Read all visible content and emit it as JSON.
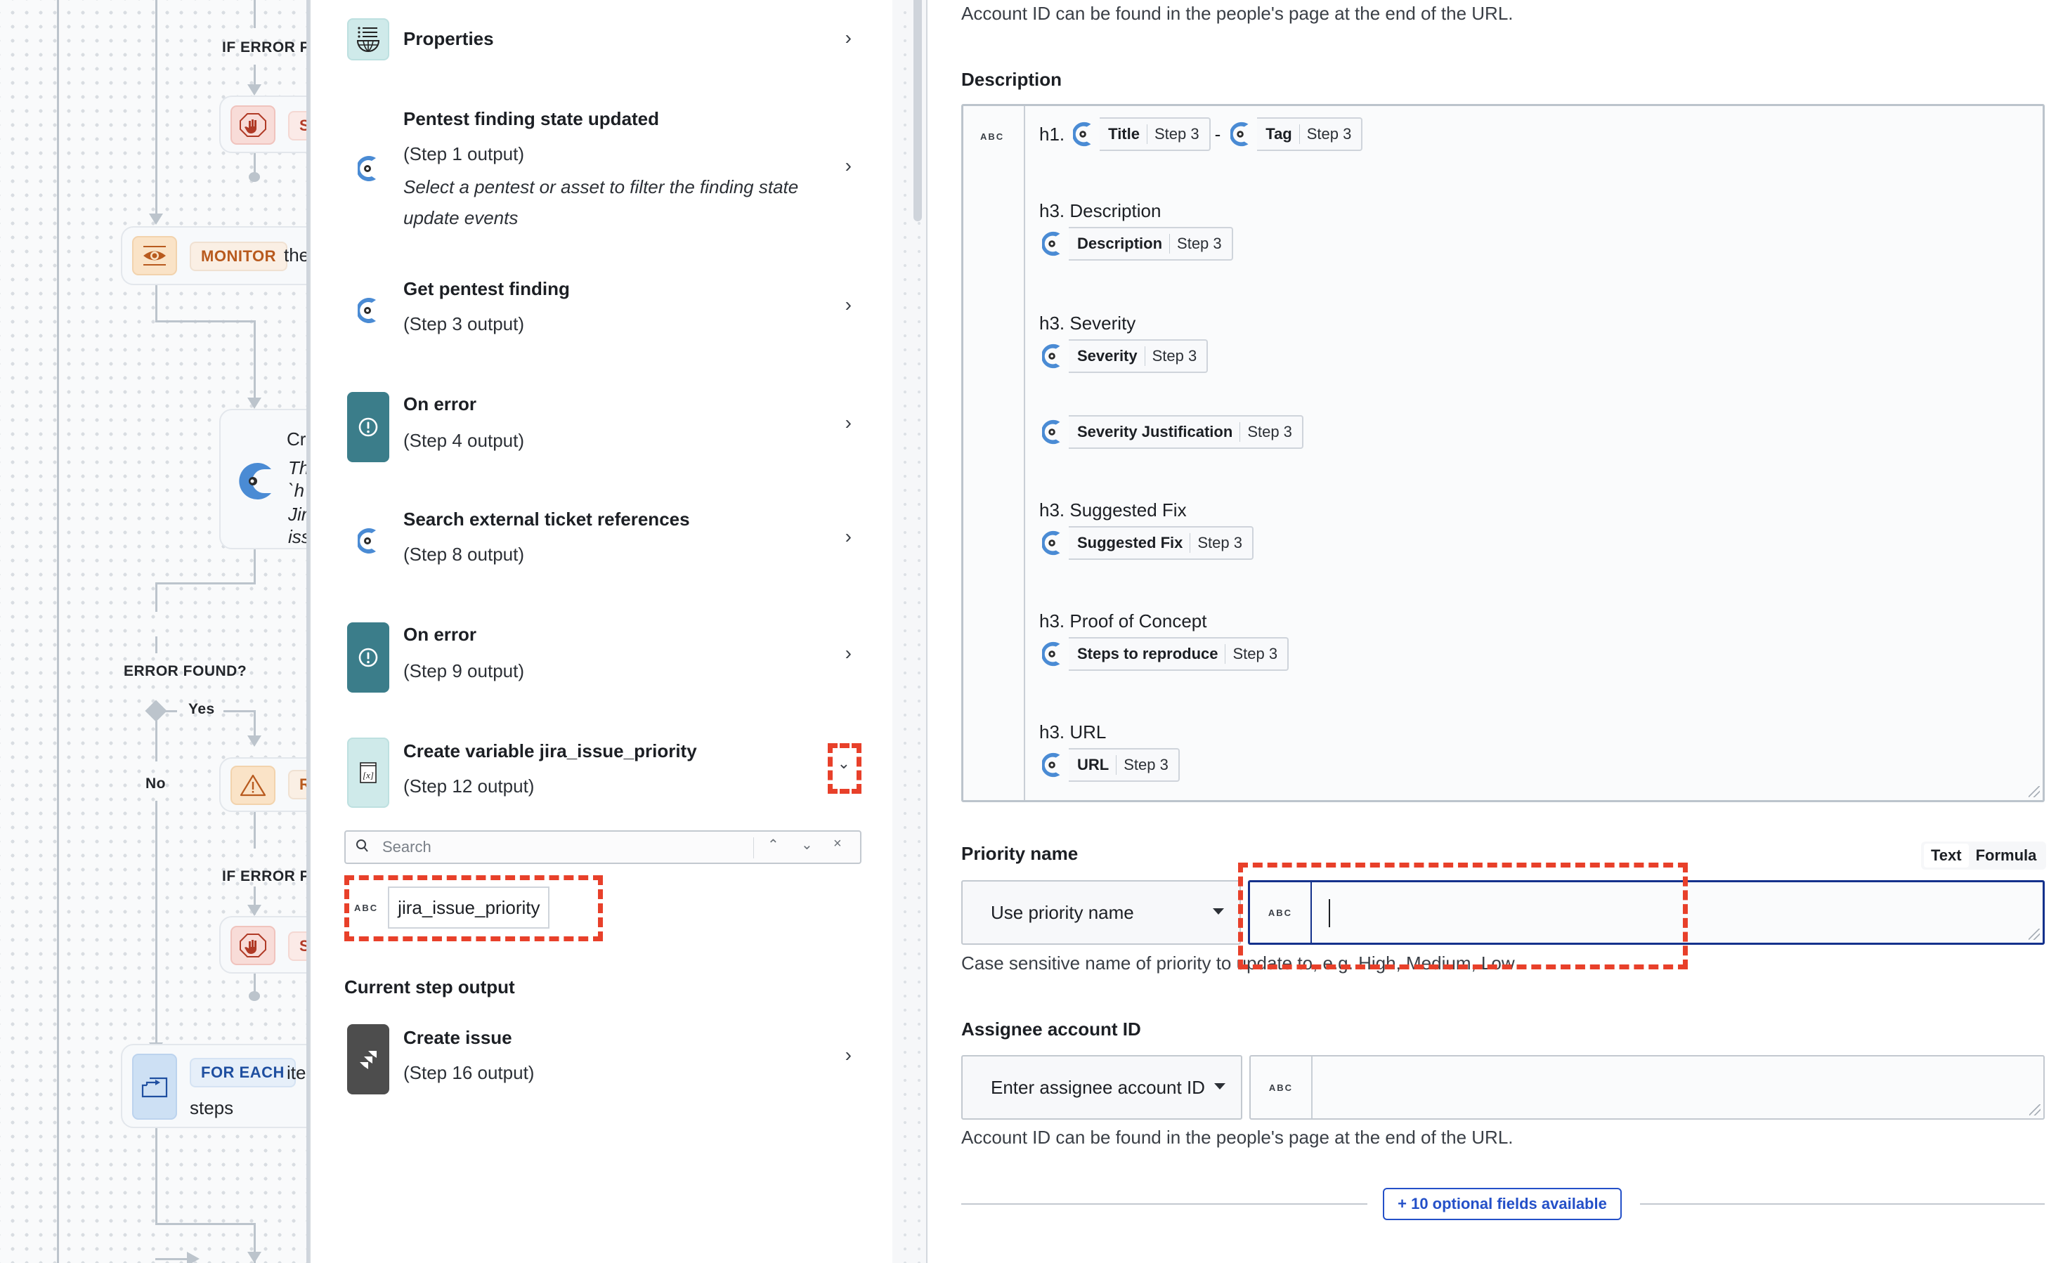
{
  "canvas": {
    "labels": {
      "if_error_top": "IF ERROR PE",
      "if_error_bottom": "IF ERROR PE",
      "error_found": "ERROR FOUND?",
      "yes": "Yes",
      "no": "No"
    },
    "nodes": {
      "stop_top_badge": "ST",
      "monitor_badge": "MONITOR",
      "monitor_text": "the",
      "create_title": "Cre",
      "create_lines": [
        "Th",
        "`h",
        "Jir",
        "iss"
      ],
      "retry_badge": "RI",
      "stop_bottom_badge": "ST",
      "foreach_badge": "FOR EACH",
      "foreach_text": "ite",
      "foreach_sub": "steps"
    }
  },
  "middle": {
    "items": [
      {
        "title": "Properties",
        "icon": "properties-globe-icon"
      },
      {
        "title": "Pentest finding state updated",
        "sub": "(Step 1 output)",
        "desc": "Select a pentest or asset to filter the finding state update events",
        "icon": "cobalt-logo-icon"
      },
      {
        "title": "Get pentest finding",
        "sub": "(Step 3 output)",
        "icon": "cobalt-logo-icon"
      },
      {
        "title": "On error",
        "sub": "(Step 4 output)",
        "icon": "error-exclamation-icon"
      },
      {
        "title": "Search external ticket references",
        "sub": "(Step 8 output)",
        "icon": "cobalt-logo-icon"
      },
      {
        "title": "On error",
        "sub": "(Step 9 output)",
        "icon": "error-exclamation-icon"
      },
      {
        "title": "Create variable jira_issue_priority",
        "sub": "(Step 12 output)",
        "icon": "variable-x-icon"
      }
    ],
    "search": {
      "placeholder": "Search"
    },
    "variable": {
      "type": "ABC",
      "name": "jira_issue_priority"
    },
    "current_step_title": "Current step output",
    "current_step": {
      "title": "Create issue",
      "sub": "(Step 16 output)",
      "icon": "jira-logo-icon"
    }
  },
  "right": {
    "top_helper": "Account ID can be found in the people's page at the end of the URL.",
    "description": {
      "label": "Description",
      "type": "ABC",
      "h1_prefix": "h1.",
      "dash": "-",
      "title_pill": {
        "name": "Title",
        "step": "Step 3"
      },
      "tag_pill": {
        "name": "Tag",
        "step": "Step 3"
      },
      "sections": [
        {
          "heading": "h3. Description",
          "pill": {
            "name": "Description",
            "step": "Step 3"
          }
        },
        {
          "heading": "h3. Severity",
          "pill": {
            "name": "Severity",
            "step": "Step 3"
          }
        },
        {
          "heading": "",
          "pill": {
            "name": "Severity Justification",
            "step": "Step 3"
          }
        },
        {
          "heading": "h3. Suggested Fix",
          "pill": {
            "name": "Suggested Fix",
            "step": "Step 3"
          }
        },
        {
          "heading": "h3. Proof of Concept",
          "pill": {
            "name": "Steps to reproduce",
            "step": "Step 3"
          }
        },
        {
          "heading": "h3. URL",
          "pill": {
            "name": "URL",
            "step": "Step 3"
          }
        }
      ]
    },
    "priority": {
      "label": "Priority name",
      "mode_text": "Text",
      "mode_formula": "Formula",
      "select_value": "Use priority name",
      "type": "ABC",
      "value": "",
      "helper": "Case sensitive name of priority to update to, e.g. High, Medium, Low"
    },
    "assignee": {
      "label": "Assignee account ID",
      "select_value": "Enter assignee account ID",
      "type": "ABC",
      "value": "",
      "helper": "Account ID can be found in the people's page at the end of the URL."
    },
    "optional_fields_button": "+ 10 optional fields available"
  },
  "colors": {
    "accent_blue": "#2450c8",
    "focus_navy": "#14318c",
    "highlight_red": "#e8402a",
    "error_teal": "#3b7d8a",
    "cobalt_blue": "#4a8bd4",
    "monitor_orange": "#b85a1e",
    "stop_red": "#b03a26",
    "foreach_blue": "#1f4fa0"
  }
}
